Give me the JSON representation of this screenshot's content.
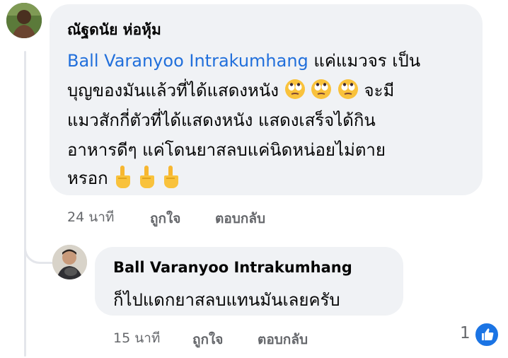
{
  "comment": {
    "author": "ณัฐดนัย ห่อหุ้ม",
    "mention": "Ball Varanyoo Intrakumhang",
    "line1_rest": " แค่แมวจร เป็น",
    "line2a": "บุญของมันแล้วที่ได้แสดงหนัง",
    "line2b": " จะมี",
    "line3": "แมวสักกี่ตัวที่ได้แสดงหนัง แสดงเสร็จได้กิน",
    "line4": "อาหารดีๆ แค่โดนยาสลบแค่นิดหน่อยไม่ตาย",
    "line5": "หรอก",
    "time": "24 นาที",
    "like_label": "ถูกใจ",
    "reply_label": "ตอบกลับ"
  },
  "reply": {
    "author": "Ball Varanyoo Intrakumhang",
    "text": "ก็ไปแดกยาสลบแทนมันเลยครับ",
    "time": "15 นาที",
    "like_label": "ถูกใจ",
    "reply_label": "ตอบกลับ",
    "reaction_count": "1"
  },
  "icons": {
    "eye_roll": "face-with-rolling-eyes-icon",
    "middle_finger": "middle-finger-icon",
    "like": "like-thumb-icon"
  },
  "colors": {
    "bubble": "#f0f2f5",
    "mention": "#216fdb",
    "meta": "#65676b",
    "like_badge": "#1b74e4"
  }
}
